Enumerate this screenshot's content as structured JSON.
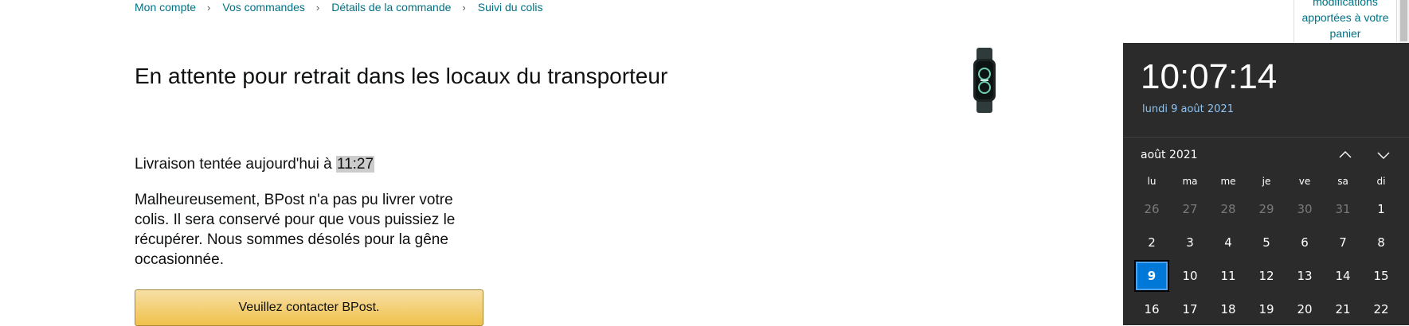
{
  "breadcrumb": {
    "items": [
      "Mon compte",
      "Vos commandes",
      "Détails de la commande",
      "Suivi du colis"
    ],
    "separator": "›"
  },
  "main": {
    "title": "En attente pour retrait dans les locaux du transporteur",
    "delivery_prefix": "Livraison tentée aujourd'hui à ",
    "delivery_time": "11:27",
    "message": "Malheureusement, BPost n'a pas pu livrer votre colis. Il sera conservé pour que vous puissiez le récupérer. Nous sommes désolés pour la gêne occasionnée.",
    "contact_button": "Veuillez contacter BPost."
  },
  "product": {
    "image_icon": "fitness-band-icon"
  },
  "cart_notice": {
    "line1": "modifications",
    "line2": "apportées à votre",
    "line3": "panier"
  },
  "clock": {
    "time": "10:07:14",
    "date": "lundi 9 août 2021",
    "month": "août 2021",
    "weekdays": [
      "lu",
      "ma",
      "me",
      "je",
      "ve",
      "sa",
      "di"
    ],
    "weeks": [
      [
        {
          "d": "26",
          "m": true
        },
        {
          "d": "27",
          "m": true
        },
        {
          "d": "28",
          "m": true
        },
        {
          "d": "29",
          "m": true
        },
        {
          "d": "30",
          "m": true
        },
        {
          "d": "31",
          "m": true
        },
        {
          "d": "1"
        }
      ],
      [
        {
          "d": "2"
        },
        {
          "d": "3"
        },
        {
          "d": "4"
        },
        {
          "d": "5"
        },
        {
          "d": "6"
        },
        {
          "d": "7"
        },
        {
          "d": "8"
        }
      ],
      [
        {
          "d": "9",
          "today": true
        },
        {
          "d": "10"
        },
        {
          "d": "11"
        },
        {
          "d": "12"
        },
        {
          "d": "13"
        },
        {
          "d": "14"
        },
        {
          "d": "15"
        }
      ],
      [
        {
          "d": "16"
        },
        {
          "d": "17"
        },
        {
          "d": "18"
        },
        {
          "d": "19"
        },
        {
          "d": "20"
        },
        {
          "d": "21"
        },
        {
          "d": "22"
        }
      ]
    ],
    "accent": "#0078d7"
  },
  "colors": {
    "link": "#007185",
    "button_top": "#f7dfa5",
    "button_bottom": "#f0c14b",
    "flyout_bg": "#2b2b2b"
  }
}
